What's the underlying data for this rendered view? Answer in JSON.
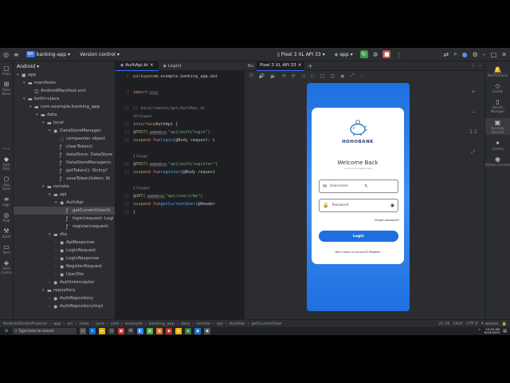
{
  "titlebar": {
    "project_badge": "BA",
    "project_name": "banking-app",
    "vcs": "Version control",
    "device": "Pixel 3 XL API 33",
    "run_config": "app"
  },
  "left_strip": [
    {
      "glyph": "▢",
      "label": "Proje"
    },
    {
      "glyph": "⊞",
      "label": "Reso Mana"
    },
    {
      "glyph": "…",
      "label": ""
    },
    {
      "glyph": "◆",
      "label": "Pyth Pack"
    },
    {
      "glyph": "⬡",
      "label": "App Quali"
    },
    {
      "glyph": "≡",
      "label": "Logc"
    },
    {
      "glyph": "◎",
      "label": "Prob"
    },
    {
      "glyph": "⚒",
      "label": "Build"
    },
    {
      "glyph": "▭",
      "label": "Term"
    },
    {
      "glyph": "◈",
      "label": "Versi Contro"
    }
  ],
  "right_strip": [
    {
      "glyph": "🔔",
      "label": "Notifications"
    },
    {
      "glyph": "◇",
      "label": "Gradle"
    },
    {
      "glyph": "▯",
      "label": "Device Manager"
    },
    {
      "glyph": "▣",
      "label": "Running Devices"
    },
    {
      "glyph": "✦",
      "label": "Gemini"
    },
    {
      "glyph": "◉",
      "label": "Python Console"
    }
  ],
  "project_panel": {
    "title": "Android"
  },
  "tree": [
    {
      "indent": 0,
      "chev": "▾",
      "icon": "▣",
      "label": "app"
    },
    {
      "indent": 1,
      "chev": "▾",
      "icon": "▬",
      "label": "manifests"
    },
    {
      "indent": 2,
      "chev": "",
      "icon": "◫",
      "label": "AndroidManifest.xml"
    },
    {
      "indent": 1,
      "chev": "▾",
      "icon": "▬",
      "label": "kotlin+java"
    },
    {
      "indent": 2,
      "chev": "▾",
      "icon": "▬",
      "label": "com.example.banking_app"
    },
    {
      "indent": 3,
      "chev": "▾",
      "icon": "▬",
      "label": "data"
    },
    {
      "indent": 4,
      "chev": "▾",
      "icon": "▬",
      "label": "local"
    },
    {
      "indent": 5,
      "chev": "▾",
      "icon": "◉",
      "label": "DataStoreManager"
    },
    {
      "indent": 6,
      "chev": "",
      "icon": "◌",
      "label": "companion object"
    },
    {
      "indent": 6,
      "chev": "",
      "icon": "ƒ",
      "label": "clearToken()"
    },
    {
      "indent": 6,
      "chev": "",
      "icon": "ƒ",
      "label": "dataStore: DataStore"
    },
    {
      "indent": 6,
      "chev": "",
      "icon": "ƒ",
      "label": "DataStoreManager(c"
    },
    {
      "indent": 6,
      "chev": "",
      "icon": "ƒ",
      "label": "getToken(): String?"
    },
    {
      "indent": 6,
      "chev": "",
      "icon": "ƒ",
      "label": "saveToken(token: St"
    },
    {
      "indent": 4,
      "chev": "▾",
      "icon": "▬",
      "label": "remote"
    },
    {
      "indent": 5,
      "chev": "▾",
      "icon": "▬",
      "label": "api"
    },
    {
      "indent": 6,
      "chev": "▾",
      "icon": "◉",
      "label": "AuthApi"
    },
    {
      "indent": 7,
      "chev": "",
      "icon": "ƒ",
      "label": "getCurrentUser(h",
      "selected": true
    },
    {
      "indent": 7,
      "chev": "",
      "icon": "ƒ",
      "label": "login(request: Logi"
    },
    {
      "indent": 7,
      "chev": "",
      "icon": "ƒ",
      "label": "register(request:"
    },
    {
      "indent": 5,
      "chev": "▾",
      "icon": "▬",
      "label": "dto"
    },
    {
      "indent": 6,
      "chev": "›",
      "icon": "◉",
      "label": "ApiResponse"
    },
    {
      "indent": 6,
      "chev": "›",
      "icon": "◉",
      "label": "LoginRequest"
    },
    {
      "indent": 6,
      "chev": "›",
      "icon": "◉",
      "label": "LoginResponse"
    },
    {
      "indent": 6,
      "chev": "›",
      "icon": "◉",
      "label": "RegisterRequest"
    },
    {
      "indent": 6,
      "chev": "›",
      "icon": "◉",
      "label": "UserDto"
    },
    {
      "indent": 5,
      "chev": "›",
      "icon": "◉",
      "label": "AuthInterceptor"
    },
    {
      "indent": 4,
      "chev": "▾",
      "icon": "▬",
      "label": "repository"
    },
    {
      "indent": 5,
      "chev": "›",
      "icon": "◉",
      "label": "AuthRepository"
    },
    {
      "indent": 5,
      "chev": "›",
      "icon": "◉",
      "label": "AuthRepositoryImpl"
    }
  ],
  "editor": {
    "tabs": [
      "AuthApi.kt",
      "LoginI"
    ],
    "lines": [
      {
        "n": "1",
        "segs": [
          [
            "kw",
            "package "
          ],
          [
            "plain",
            "com.example.banking_app.dat"
          ]
        ]
      },
      {
        "n": "",
        "segs": []
      },
      {
        "n": "3",
        "segs": [
          [
            "kw",
            "import "
          ],
          [
            "inlay",
            "..."
          ]
        ]
      },
      {
        "n": "",
        "segs": []
      },
      {
        "n": "11",
        "segs": [
          [
            "cmt",
            "// data/remote/api/AuthApi.kt"
          ]
        ]
      },
      {
        "n": "",
        "segs": [
          [
            "hint",
            "20 Usages"
          ]
        ]
      },
      {
        "n": "12",
        "segs": [
          [
            "kw",
            "interface "
          ],
          [
            "plain",
            "AuthApi {"
          ]
        ]
      },
      {
        "n": "13",
        "segs": [
          [
            "ann",
            "@POST("
          ],
          [
            "inlay",
            "value ="
          ],
          [
            "str",
            "\"api/auth/login\""
          ],
          [
            "ann",
            ")"
          ]
        ]
      },
      {
        "n": "14",
        "segs": [
          [
            "kw",
            "suspend fun "
          ],
          [
            "fn",
            "login"
          ],
          [
            "plain",
            "(@Body request: L"
          ]
        ]
      },
      {
        "n": "",
        "segs": []
      },
      {
        "n": "",
        "segs": [
          [
            "hint",
            "1 Usage"
          ]
        ]
      },
      {
        "n": "16",
        "segs": [
          [
            "ann",
            "@POST("
          ],
          [
            "inlay",
            "value ="
          ],
          [
            "str",
            "\"api/auth/register\""
          ],
          [
            "ann",
            ")"
          ]
        ]
      },
      {
        "n": "17",
        "segs": [
          [
            "kw",
            "suspend fun "
          ],
          [
            "fn",
            "register"
          ],
          [
            "plain",
            "(@Body request"
          ]
        ]
      },
      {
        "n": "",
        "segs": []
      },
      {
        "n": "",
        "segs": [
          [
            "hint",
            "2 Usages"
          ]
        ]
      },
      {
        "n": "21",
        "segs": [
          [
            "ann",
            "@GET("
          ],
          [
            "inlay",
            "value ="
          ],
          [
            "str",
            "\"api/users/me\""
          ],
          [
            "ann",
            ")"
          ]
        ]
      },
      {
        "n": "22",
        "segs": [
          [
            "kw",
            "suspend fun "
          ],
          [
            "fn",
            "getCurrentUser"
          ],
          [
            "plain",
            "(@Header"
          ]
        ]
      },
      {
        "n": "23",
        "segs": [
          [
            "plain",
            "}"
          ]
        ]
      }
    ]
  },
  "running_devices": {
    "tab": "Pixel 3 XL API 33"
  },
  "app_screen": {
    "brand": "HOHOBANK",
    "welcome": "Welcome Back",
    "tagline": "Your trusted digital bank",
    "username_placeholder": "Username",
    "password_placeholder": "Password",
    "forgot": "Forgot password?",
    "login": "Login",
    "register": "Don't have an account? Register"
  },
  "statusbar": {
    "crumbs": [
      "AndroidStudioProjects",
      "app",
      "src",
      "main",
      "java",
      "com",
      "example",
      "banking_app",
      "data",
      "remote",
      "api",
      "AuthApi",
      "getCurrentUser"
    ],
    "pos": "21:20",
    "eol": "CRLF",
    "enc": "UTF-8",
    "indent": "4 spaces"
  },
  "taskbar": {
    "search": "Type here to search",
    "time": "10:50 AM",
    "date": "6/29/2025"
  },
  "colors": {
    "accent": "#3574f0",
    "app_blue": "#1e6fe0"
  }
}
